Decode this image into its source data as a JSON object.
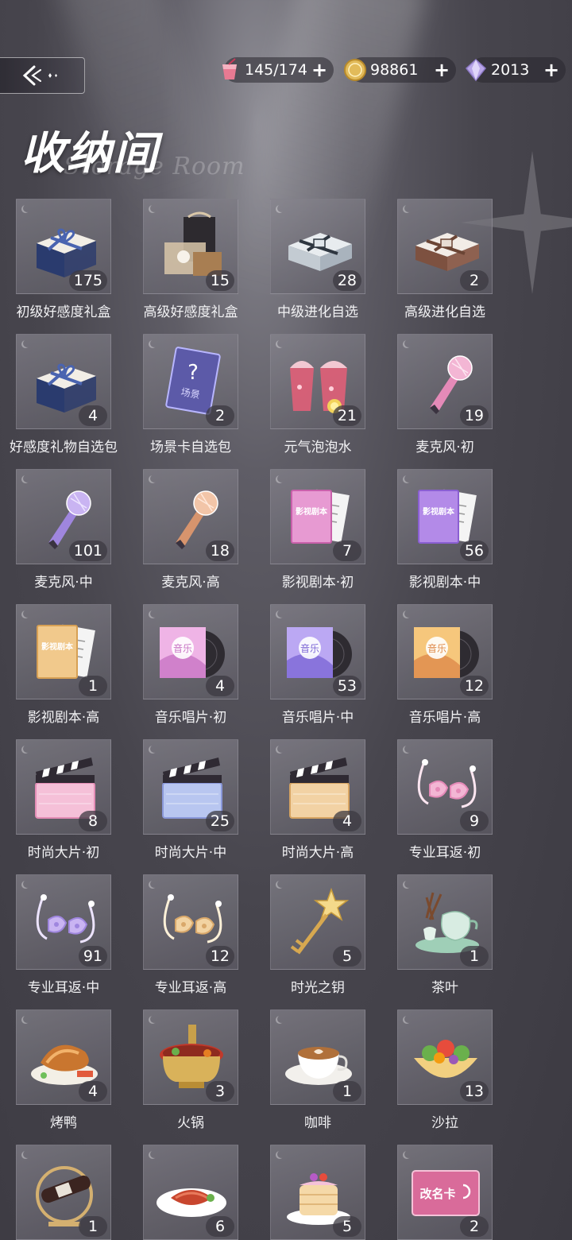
{
  "currencies": {
    "stamina": {
      "value": "145/174",
      "icon": "pink-drink-icon"
    },
    "gold": {
      "value": "98861",
      "icon": "gold-coin-icon"
    },
    "diamond": {
      "value": "2013",
      "icon": "purple-diamond-icon"
    }
  },
  "page": {
    "title": "收纳间",
    "subtitle": "Storage Room"
  },
  "items": [
    {
      "label": "初级好感度礼盒",
      "count": "175",
      "icon": "navy-gift-box-icon"
    },
    {
      "label": "高级好感度礼盒",
      "count": "15",
      "icon": "luxury-gift-set-icon"
    },
    {
      "label": "中级进化自选",
      "count": "28",
      "icon": "silver-box-icon"
    },
    {
      "label": "高级进化自选",
      "count": "2",
      "icon": "bronze-box-icon"
    },
    {
      "label": "好感度礼物自选包",
      "count": "4",
      "icon": "navy-gift-box-icon"
    },
    {
      "label": "场景卡自选包",
      "count": "2",
      "icon": "mystery-scene-card-icon"
    },
    {
      "label": "元气泡泡水",
      "count": "21",
      "icon": "bubble-drink-icon"
    },
    {
      "label": "麦克风·初",
      "count": "19",
      "icon": "pink-microphone-icon"
    },
    {
      "label": "麦克风·中",
      "count": "101",
      "icon": "purple-microphone-icon"
    },
    {
      "label": "麦克风·高",
      "count": "18",
      "icon": "gold-microphone-icon"
    },
    {
      "label": "影视剧本·初",
      "count": "7",
      "icon": "pink-script-icon"
    },
    {
      "label": "影视剧本·中",
      "count": "56",
      "icon": "purple-script-icon"
    },
    {
      "label": "影视剧本·高",
      "count": "1",
      "icon": "gold-script-icon"
    },
    {
      "label": "音乐唱片·初",
      "count": "4",
      "icon": "pink-record-icon"
    },
    {
      "label": "音乐唱片·中",
      "count": "53",
      "icon": "purple-record-icon"
    },
    {
      "label": "音乐唱片·高",
      "count": "12",
      "icon": "gold-record-icon"
    },
    {
      "label": "时尚大片·初",
      "count": "8",
      "icon": "pink-clapperboard-icon"
    },
    {
      "label": "时尚大片·中",
      "count": "25",
      "icon": "purple-clapperboard-icon"
    },
    {
      "label": "时尚大片·高",
      "count": "4",
      "icon": "gold-clapperboard-icon"
    },
    {
      "label": "专业耳返·初",
      "count": "9",
      "icon": "pink-earphones-icon"
    },
    {
      "label": "专业耳返·中",
      "count": "91",
      "icon": "purple-earphones-icon"
    },
    {
      "label": "专业耳返·高",
      "count": "12",
      "icon": "gold-earphones-icon"
    },
    {
      "label": "时光之钥",
      "count": "5",
      "icon": "star-key-icon"
    },
    {
      "label": "茶叶",
      "count": "1",
      "icon": "tea-set-icon"
    },
    {
      "label": "烤鸭",
      "count": "4",
      "icon": "roast-duck-icon"
    },
    {
      "label": "火锅",
      "count": "3",
      "icon": "hotpot-icon"
    },
    {
      "label": "咖啡",
      "count": "1",
      "icon": "coffee-cup-icon"
    },
    {
      "label": "沙拉",
      "count": "13",
      "icon": "salad-bowl-icon"
    },
    {
      "label": "",
      "count": "1",
      "icon": "wine-bottle-icon"
    },
    {
      "label": "",
      "count": "6",
      "icon": "meat-dish-icon"
    },
    {
      "label": "",
      "count": "5",
      "icon": "pancake-stack-icon"
    },
    {
      "label": "",
      "count": "2",
      "icon": "rename-card-icon"
    }
  ],
  "rename_card_text": "改名卡",
  "script_cover_text": "影视剧本",
  "record_cover_text": "音乐",
  "scene_card_text": "场景",
  "colors": {
    "count_badge_bg": "#3c3a42",
    "label_text": "#f2f2f4",
    "background": "#47454d"
  }
}
